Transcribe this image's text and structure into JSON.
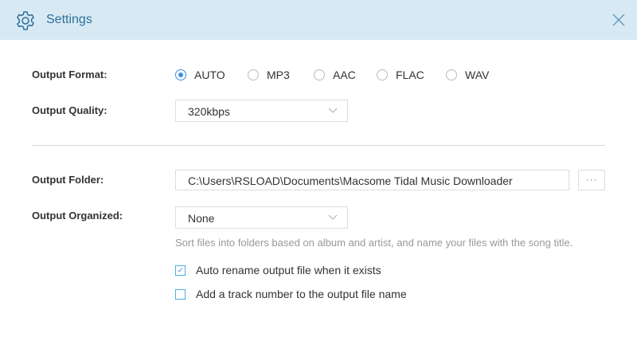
{
  "header": {
    "title": "Settings"
  },
  "output_format": {
    "label": "Output Format:",
    "options": [
      {
        "label": "AUTO",
        "selected": true
      },
      {
        "label": "MP3",
        "selected": false
      },
      {
        "label": "AAC",
        "selected": false
      },
      {
        "label": "FLAC",
        "selected": false
      },
      {
        "label": "WAV",
        "selected": false
      }
    ]
  },
  "output_quality": {
    "label": "Output Quality:",
    "value": "320kbps"
  },
  "output_folder": {
    "label": "Output Folder:",
    "value": "C:\\Users\\RSLOAD\\Documents\\Macsome Tidal Music Downloader",
    "browse": "···"
  },
  "output_organized": {
    "label": "Output Organized:",
    "value": "None",
    "hint": "Sort files into folders based on album and artist, and name your files with the song title."
  },
  "checkboxes": [
    {
      "label": "Auto rename output file when it exists",
      "checked": true
    },
    {
      "label": "Add a track number to the output file name",
      "checked": false
    }
  ],
  "colors": {
    "accent": "#3a8ee6",
    "header_bg": "#d7eaf4"
  }
}
